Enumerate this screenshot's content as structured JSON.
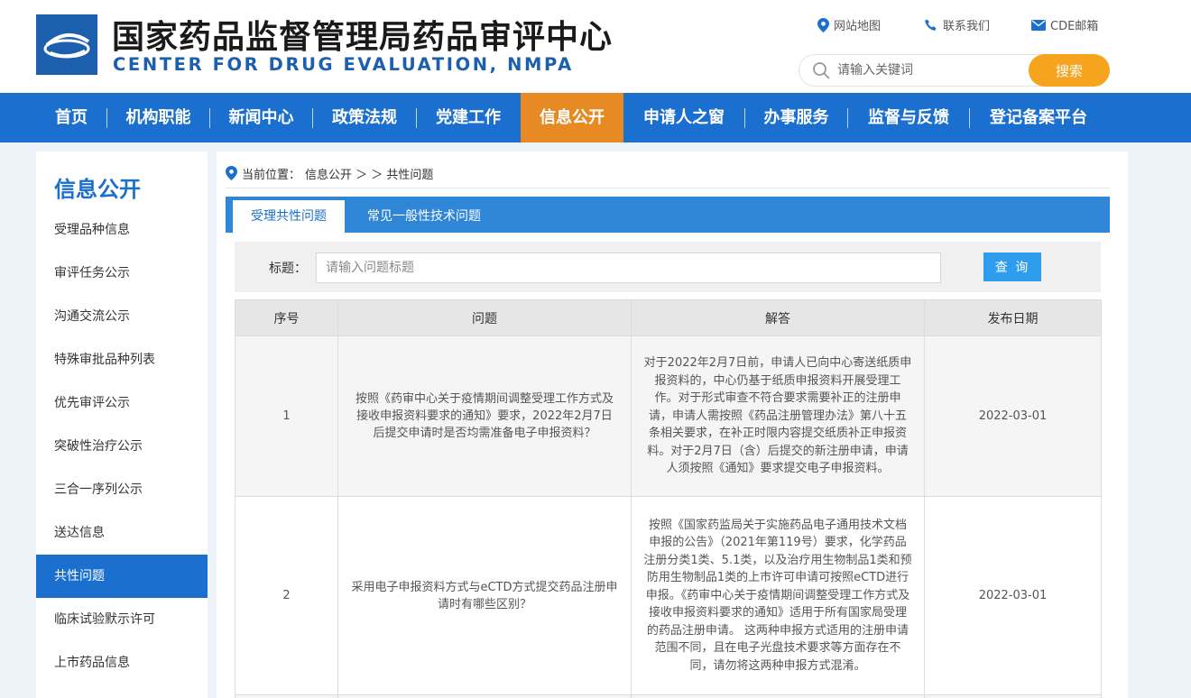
{
  "header": {
    "title": "国家药品监督管理局药品审评中心",
    "subtitle": "CENTER FOR DRUG EVALUATION, NMPA",
    "links": [
      {
        "label": "网站地图",
        "icon": "location-icon"
      },
      {
        "label": "联系我们",
        "icon": "phone-icon"
      },
      {
        "label": "CDE邮箱",
        "icon": "mail-icon"
      }
    ],
    "search": {
      "placeholder": "请输入关键词",
      "button": "搜索"
    }
  },
  "nav": {
    "items": [
      "首页",
      "机构职能",
      "新闻中心",
      "政策法规",
      "党建工作",
      "信息公开",
      "申请人之窗",
      "办事服务",
      "监督与反馈",
      "登记备案平台"
    ],
    "active": "信息公开"
  },
  "sidebar": {
    "title": "信息公开",
    "items": [
      "受理品种信息",
      "审评任务公示",
      "沟通交流公示",
      "特殊审批品种列表",
      "优先审评公示",
      "突破性治疗公示",
      "三合一序列公示",
      "送达信息",
      "共性问题",
      "临床试验默示许可",
      "上市药品信息"
    ],
    "active": "共性问题"
  },
  "breadcrumb": {
    "prefix": "当前位置：",
    "path": "信息公开 ＞ ＞ 共性问题"
  },
  "tabs": [
    {
      "label": "受理共性问题",
      "active": true
    },
    {
      "label": "常见一般性技术问题",
      "active": false
    }
  ],
  "filter": {
    "label": "标题：",
    "placeholder": "请输入问题标题",
    "button": "查 询"
  },
  "table": {
    "headers": [
      "序号",
      "问题",
      "解答",
      "发布日期"
    ],
    "rows": [
      {
        "no": "1",
        "question": "按照《药审中心关于疫情期间调整受理工作方式及接收申报资料要求的通知》要求，2022年2月7日后提交申请时是否均需准备电子申报资料？",
        "answer": "对于2022年2月7日前，申请人已向中心寄送纸质申报资料的，中心仍基于纸质申报资料开展受理工作。对于形式审查不符合要求需要补正的注册申请，申请人需按照《药品注册管理办法》第八十五条相关要求，在补正时限内容提交纸质补正申报资料。对于2月7日（含）后提交的新注册申请，申请人须按照《通知》要求提交电子申报资料。",
        "date": "2022-03-01"
      },
      {
        "no": "2",
        "question": "采用电子申报资料方式与eCTD方式提交药品注册申请时有哪些区别？",
        "answer": "按照《国家药监局关于实施药品电子通用技术文档申报的公告》（2021年第119号）要求，化学药品注册分类1类、5.1类，以及治疗用生物制品1类和预防用生物制品1类的上市许可申请可按照eCTD进行申报。《药审中心关于疫情期间调整受理工作方式及接收申报资料要求的通知》适用于所有国家局受理的药品注册申请。 这两种申报方式适用的注册申请范围不同，且在电子光盘技术要求等方面存在不同，请勿将这两种申报方式混淆。",
        "date": "2022-03-01"
      }
    ]
  },
  "colors": {
    "brand_blue": "#1b6fce",
    "active_orange": "#e78a24",
    "search_orange": "#f6a31e",
    "query_blue": "#2f9ded"
  }
}
